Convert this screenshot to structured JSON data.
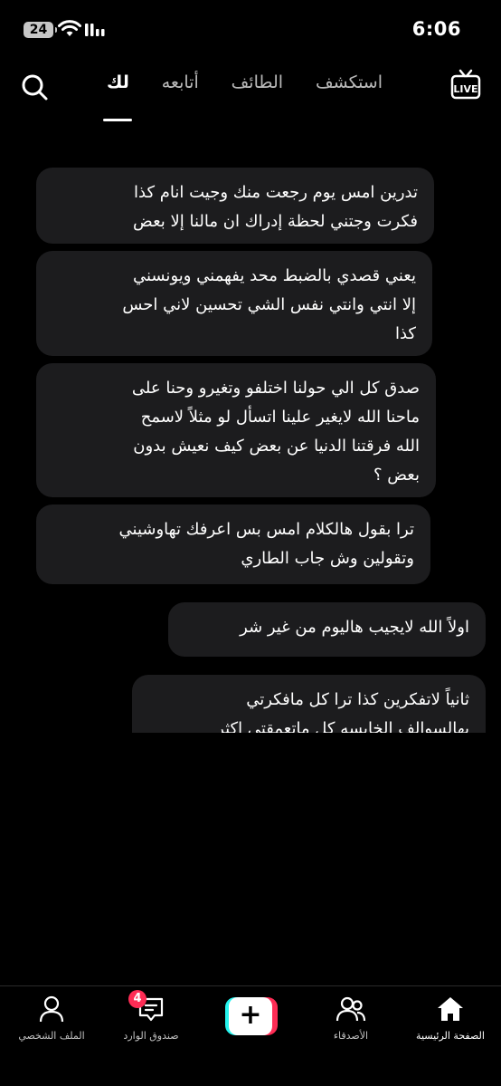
{
  "status_bar": {
    "battery": "24",
    "time": "6:06",
    "icons": [
      "battery-icon",
      "wifi-icon",
      "signal-icon"
    ]
  },
  "top_nav": {
    "tabs": [
      {
        "label": "استكشف",
        "active": false
      },
      {
        "label": "الطائف",
        "active": false
      },
      {
        "label": "أتابعه",
        "active": false
      },
      {
        "label": "لك",
        "active": true
      }
    ],
    "icons": [
      "live-icon",
      "search-icon"
    ]
  },
  "messages": [
    {
      "text": "تدرين امس يوم رجعت منك وجيت انام كذا\nفكرت وجتني لحظة إدراك ان مالنا إلا بعض"
    },
    {
      "text": "يعني قصدي بالضبط محد يفهمني ويونسني\nإلا انتي وانتي نفس الشي تحسين لاني احس\nكذا"
    },
    {
      "text": "صدق كل الي حولنا اختلفو وتغيرو وحنا على\nماحنا الله لايغير علينا اتسأل لو مثلاً لاسمح\nالله فرقتنا الدنيا عن بعض كيف نعيش بدون\nبعض ؟"
    },
    {
      "text": "ترا بقول هالكلام امس بس اعرفك تهاوشيني\nوتقولين وش جاب الطاري"
    },
    {
      "text": "اولاً الله لايجيب هاليوم من غير شر"
    },
    {
      "text": "ثانياً لاتفكرين كذا ترا كل مافكرتي\nبهالسوالف الخايسه كل ماتعمقتي اكثر"
    }
  ],
  "bottom_bar": {
    "home_label": "الصفحة الرئيسية",
    "friends_label": "الأصدقاء",
    "create_symbol": "+",
    "inbox_label": "صندوق الوارد",
    "inbox_badge": "4",
    "profile_label": "الملف الشخصي",
    "colors": {
      "accent_red": "#fe2c55",
      "accent_cyan": "#25f4ee"
    }
  }
}
